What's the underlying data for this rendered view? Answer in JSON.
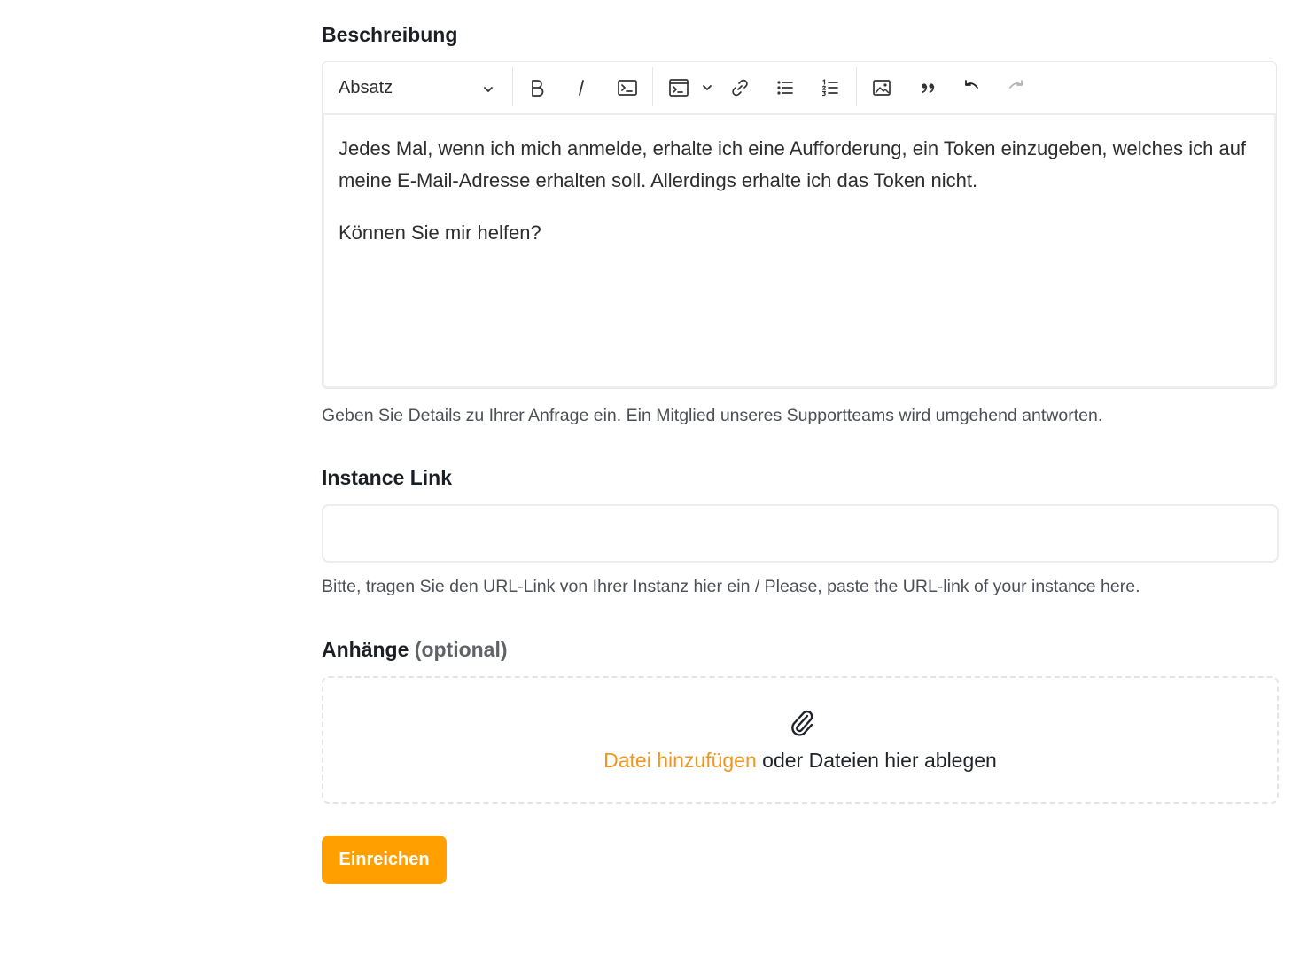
{
  "description": {
    "label": "Beschreibung",
    "toolbar": {
      "block_format": "Absatz",
      "icons": [
        "chevron-down-icon",
        "bold-icon",
        "italic-icon",
        "code-icon",
        "code-block-icon",
        "link-icon",
        "bulleted-list-icon",
        "numbered-list-icon",
        "image-icon",
        "quote-icon",
        "undo-icon",
        "redo-icon"
      ]
    },
    "paragraphs": [
      "Jedes Mal, wenn ich mich anmelde, erhalte ich eine Aufforderung, ein Token einzugeben, welches ich auf meine E-Mail-Adresse erhalten soll. Allerdings erhalte ich das Token nicht.",
      "Können Sie mir helfen?"
    ],
    "help": "Geben Sie Details zu Ihrer Anfrage ein. Ein Mitglied unseres Supportteams wird umgehend antworten."
  },
  "instance_link": {
    "label": "Instance Link",
    "value": "",
    "help": "Bitte, tragen Sie den URL-Link von Ihrer Instanz hier ein / Please, paste the URL-link of your instance here."
  },
  "attachments": {
    "label": "Anhänge",
    "optional": "(optional)",
    "add_file": "Datei hinzufügen",
    "drop_text": " oder Dateien hier ablegen",
    "icon": "paperclip-icon"
  },
  "submit_label": "Einreichen",
  "colors": {
    "accent": "#ff9f00",
    "link": "#f0961e"
  }
}
